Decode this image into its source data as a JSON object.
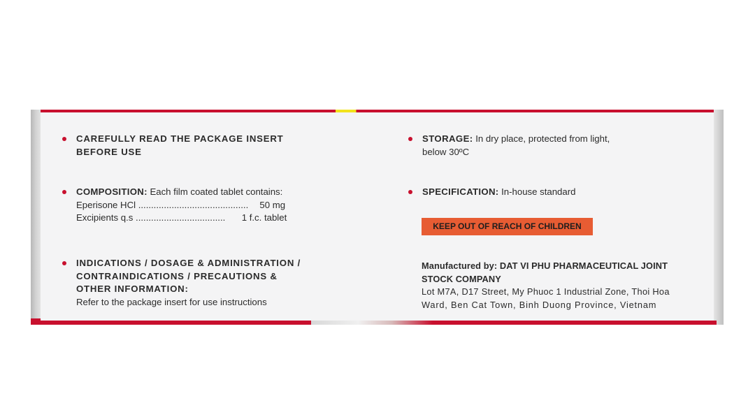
{
  "package": {
    "left": {
      "read_insert": {
        "line1": "CAREFULLY READ THE PACKAGE INSERT",
        "line2": "BEFORE USE"
      },
      "composition": {
        "label": "COMPOSITION:",
        "intro": "Each film coated tablet contains:",
        "ingredient1_name": "Eperisone HCl",
        "ingredient1_dots": "...........................................",
        "ingredient1_value": "50 mg",
        "ingredient2_name": "Excipients q.s",
        "ingredient2_dots": "...................................",
        "ingredient2_value": "1 f.c. tablet"
      },
      "indications": {
        "line1": "INDICATIONS / DOSAGE & ADMINISTRATION /",
        "line2": "CONTRAINDICATIONS / PRECAUTIONS &",
        "line3": "OTHER INFORMATION:",
        "note": "Refer to the package insert for use instructions"
      }
    },
    "right": {
      "storage": {
        "label": "STORAGE:",
        "text1": "In dry place, protected from light,",
        "text2": "below 30ºC"
      },
      "specification": {
        "label": "SPECIFICATION:",
        "text": "In-house standard"
      },
      "warning": "KEEP OUT OF REACH OF CHILDREN",
      "manufacturer": {
        "line1": "Manufactured by: DAT VI PHU PHARMACEUTICAL JOINT",
        "line2": "STOCK COMPANY",
        "address1": "Lot M7A, D17 Street, My Phuoc 1 Industrial Zone, Thoi Hoa",
        "address2": "Ward, Ben Cat Town, Binh Duong Province, Vietnam"
      }
    },
    "colors": {
      "accent_red": "#c8102e",
      "warning_orange": "#e75c33",
      "panel": "#f4f4f5"
    }
  }
}
